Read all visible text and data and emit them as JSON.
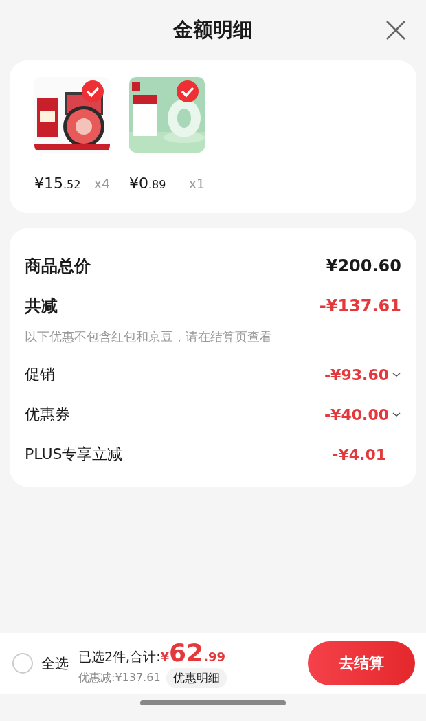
{
  "header": {
    "title": "金额明细"
  },
  "products": [
    {
      "kind": "picture",
      "checked": true,
      "price_integer": "¥15",
      "price_fraction": ".52",
      "quantity": "x4"
    },
    {
      "kind": "picture",
      "checked": true,
      "price_integer": "¥0",
      "price_fraction": ".89",
      "quantity": "x1"
    }
  ],
  "summary": [
    {
      "kind": "total",
      "label": "商品总价",
      "amount": "¥200.60"
    },
    {
      "kind": "discount",
      "label": "共减",
      "amount": "-¥137.61",
      "note": "以下优惠不包含红包和京豆，请在结算页查看"
    },
    {
      "kind": "item",
      "label": "促销",
      "amount": "-¥93.60",
      "expandable": true
    },
    {
      "kind": "item",
      "label": "优惠券",
      "amount": "-¥40.00",
      "expandable": true
    },
    {
      "kind": "item",
      "label": "PLUS专享立减",
      "amount": "-¥4.01",
      "expandable": false
    }
  ],
  "footer": {
    "select_all": {
      "label": "全选",
      "checked": false
    },
    "selected_count": "已选2件,合计:",
    "total_currency": "¥",
    "total_integer": "62",
    "total_fraction": ".99",
    "saved": "优惠减:¥137.61",
    "details_button": "优惠明细",
    "checkout_button": "去结算"
  }
}
